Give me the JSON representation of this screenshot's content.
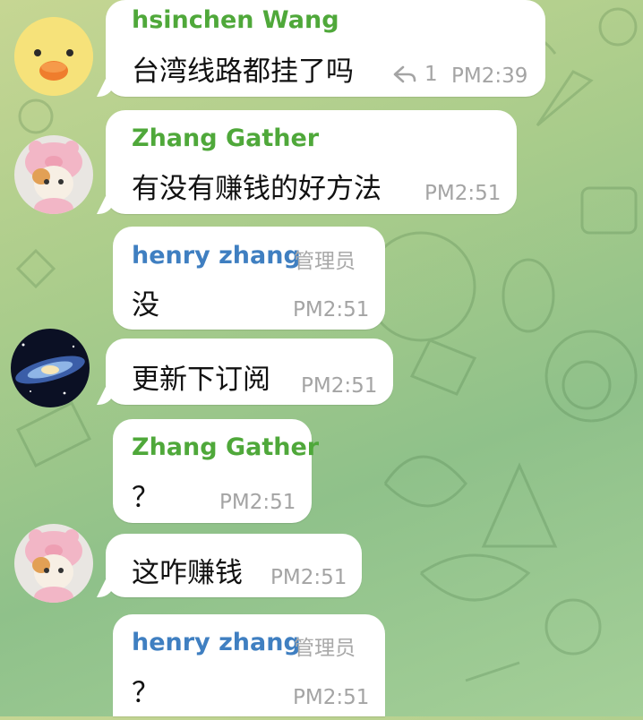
{
  "messages": [
    {
      "sender": "hsinchen Wang",
      "text": "台湾线路都挂了吗",
      "replies": "1",
      "time": "PM2:39"
    },
    {
      "sender": "Zhang Gather",
      "text": "有没有赚钱的好方法",
      "time": "PM2:51"
    },
    {
      "sender": "henry zhang",
      "role": "管理员",
      "text": "没",
      "time": "PM2:51"
    },
    {
      "text": "更新下订阅",
      "time": "PM2:51"
    },
    {
      "sender": "Zhang Gather",
      "text": "？",
      "time": "PM2:51"
    },
    {
      "text": "这咋赚钱",
      "time": "PM2:51"
    },
    {
      "sender": "henry zhang",
      "role": "管理员",
      "text": "？",
      "time": "PM2:51"
    }
  ],
  "colors": {
    "green_name": "#4fa83a",
    "blue_name": "#3f7fc1",
    "meta_gray": "#a4a4a4"
  },
  "icons": [
    "reply-arrow-icon",
    "duck-avatar",
    "cat-avatar",
    "galaxy-avatar"
  ]
}
